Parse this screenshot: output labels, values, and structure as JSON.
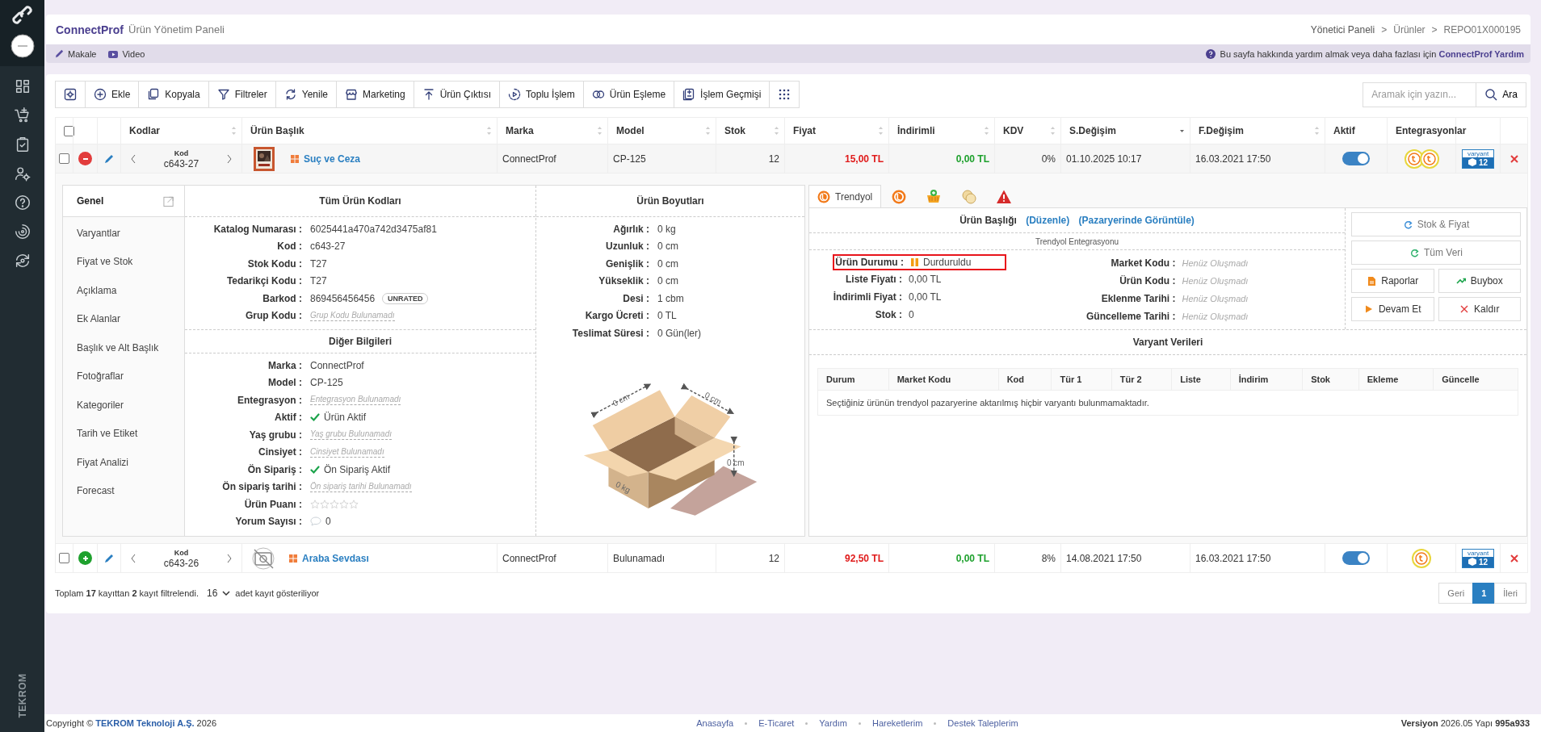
{
  "sidebar": {
    "brand": "TEKROM"
  },
  "header": {
    "app_name": "ConnectProf",
    "subtitle": "Ürün Yönetim Paneli",
    "breadcrumb": [
      "Yönetici Paneli",
      ">",
      "Ürünler",
      ">",
      "REPO01X000195"
    ]
  },
  "help_bar": {
    "links": [
      "Makale",
      "Video"
    ],
    "help_text": "Bu sayfa hakkında yardım almak veya daha fazlası için",
    "help_link": "ConnectProf Yardım"
  },
  "toolbar": {
    "buttons": [
      {
        "kind": "icon"
      },
      {
        "kind": "labeled",
        "label": "Ekle"
      },
      {
        "kind": "labeled",
        "label": "Kopyala"
      },
      {
        "kind": "labeled",
        "label": "Filtreler"
      },
      {
        "kind": "labeled",
        "label": "Yenile"
      },
      {
        "kind": "labeled",
        "label": "Marketing"
      },
      {
        "kind": "labeled",
        "label": "Ürün Çıktısı"
      },
      {
        "kind": "labeled",
        "label": "Toplu İşlem"
      },
      {
        "kind": "labeled",
        "label": "Ürün Eşleme"
      },
      {
        "kind": "labeled",
        "label": "İşlem Geçmişi"
      },
      {
        "kind": "icon"
      }
    ]
  },
  "search": {
    "placeholder": "Aramak için yazın...",
    "button": "Ara"
  },
  "table": {
    "header_checkbox": {
      "checked": false
    },
    "columns": [
      {
        "label": "Kodlar",
        "sortable": true,
        "sorted": false
      },
      {
        "label": "Ürün Başlık",
        "sortable": true,
        "sorted": false
      },
      {
        "label": "Marka",
        "sortable": true,
        "sorted": false
      },
      {
        "label": "Model",
        "sortable": true,
        "sorted": false
      },
      {
        "label": "Stok",
        "sortable": true,
        "sorted": false
      },
      {
        "label": "Fiyat",
        "sortable": true,
        "sorted": false
      },
      {
        "label": "İndirimli",
        "sortable": true,
        "sorted": false
      },
      {
        "label": "KDV",
        "sortable": true,
        "sorted": false
      },
      {
        "label": "S.Değişim",
        "sortable": true,
        "sorted": true
      },
      {
        "label": "F.Değişim",
        "sortable": true,
        "sorted": false
      },
      {
        "label": "Aktif",
        "sortable": false
      },
      {
        "label": "Entegrasyonlar",
        "sortable": false
      }
    ],
    "rows": [
      {
        "checked": false,
        "expanded": true,
        "code_label": "Kod",
        "code": "c643-27",
        "image": {
          "kind": "picture"
        },
        "title": "Suç ve Ceza",
        "brand": "ConnectProf",
        "model": "CP-125",
        "stock": "12",
        "price": "15,00 TL",
        "discount_price": "0,00 TL",
        "vat": "0%",
        "s_date": "01.10.2025 10:17",
        "f_date": "16.03.2021 17:50",
        "active": true,
        "integrations": [
          {
            "kind": "marketplace"
          },
          {
            "kind": "marketplace"
          }
        ],
        "variant_label": "varyant",
        "variant_count": "12",
        "detail": {
          "nav": [
            {
              "label": "Genel",
              "selected": true
            },
            {
              "label": "Varyantlar",
              "selected": false
            },
            {
              "label": "Fiyat ve Stok",
              "selected": false
            },
            {
              "label": "Açıklama",
              "selected": false
            },
            {
              "label": "Ek Alanlar",
              "selected": false
            },
            {
              "label": "Başlık ve Alt Başlık",
              "selected": false
            },
            {
              "label": "Fotoğraflar",
              "selected": false
            },
            {
              "label": "Kategoriler",
              "selected": false
            },
            {
              "label": "Tarih ve Etiket",
              "selected": false
            },
            {
              "label": "Fiyat Analizi",
              "selected": false
            },
            {
              "label": "Forecast",
              "selected": false
            }
          ],
          "codes": {
            "title": "Tüm Ürün Kodları",
            "fields": [
              {
                "label": "Katalog Numarası :",
                "kind": "text",
                "value": "6025441a470a742d3475af81"
              },
              {
                "label": "Kod :",
                "kind": "text",
                "value": "c643-27"
              },
              {
                "label": "Stok Kodu :",
                "kind": "text",
                "value": "T27"
              },
              {
                "label": "Tedarikçi Kodu :",
                "kind": "text",
                "value": "T27"
              },
              {
                "label": "Barkod :",
                "kind": "badge",
                "value": "869456456456",
                "badge": "UNRATED"
              },
              {
                "label": "Grup Kodu :",
                "kind": "missing",
                "value": "Grup Kodu Bulunamadı"
              }
            ]
          },
          "other": {
            "title": "Diğer Bilgileri",
            "fields": [
              {
                "label": "Marka :",
                "kind": "text",
                "value": "ConnectProf"
              },
              {
                "label": "Model :",
                "kind": "text",
                "value": "CP-125"
              },
              {
                "label": "Entegrasyon :",
                "kind": "missing",
                "value": "Entegrasyon Bulunamadı"
              },
              {
                "label": "Aktif :",
                "kind": "check",
                "value": "Ürün Aktif"
              },
              {
                "label": "Yaş grubu :",
                "kind": "missing",
                "value": "Yaş grubu Bulunamadı"
              },
              {
                "label": "Cinsiyet :",
                "kind": "missing",
                "value": "Cinsiyet Bulunamadı"
              },
              {
                "label": "Ön Sipariş :",
                "kind": "check",
                "value": "Ön Sipariş Aktif"
              },
              {
                "label": "Ön sipariş tarihi :",
                "kind": "missing",
                "value": "Ön sipariş tarihi Bulunamadı"
              },
              {
                "label": "Ürün Puanı :",
                "kind": "stars",
                "stars": 0
              },
              {
                "label": "Yorum Sayısı :",
                "kind": "comment",
                "value": "0"
              }
            ]
          },
          "dimensions": {
            "title": "Ürün Boyutları",
            "fields": [
              {
                "label": "Ağırlık :",
                "kind": "text",
                "value": "0 kg"
              },
              {
                "label": "Uzunluk :",
                "kind": "text",
                "value": "0 cm"
              },
              {
                "label": "Genişlik :",
                "kind": "text",
                "value": "0 cm"
              },
              {
                "label": "Yükseklik :",
                "kind": "text",
                "value": "0 cm"
              },
              {
                "label": "Desi :",
                "kind": "text",
                "value": "1 cbm"
              },
              {
                "label": "Kargo Ücreti :",
                "kind": "text",
                "value": "0 TL"
              },
              {
                "label": "Teslimat Süresi :",
                "kind": "text",
                "value": "0 Gün(ler)"
              }
            ],
            "box_labels": {
              "length": "0 cm",
              "width": "0 cm",
              "height": "0 cm",
              "weight": "0 kg"
            }
          },
          "marketplace": {
            "tabs": [
              {
                "label": "Trendyol",
                "selected": true
              },
              {
                "selected": false
              },
              {
                "selected": false
              },
              {
                "selected": false
              },
              {
                "selected": false
              }
            ],
            "title_label": "Ürün Başlığı",
            "title_links": [
              "(Düzenle)",
              "(Pazaryerinde Görüntüle)"
            ],
            "integration_label": "Trendyol Entegrasyonu",
            "status": {
              "label": "Ürün Durumu :",
              "value": "Durduruldu",
              "highlighted": true
            },
            "left_fields": [
              {
                "label": "Liste Fiyatı :",
                "value": "0,00 TL"
              },
              {
                "label": "İndirimli Fiyat :",
                "value": "0,00 TL"
              },
              {
                "label": "Stok :",
                "value": "0"
              }
            ],
            "right_fields": [
              {
                "label": "Market Kodu :",
                "value": "Henüz Oluşmadı"
              },
              {
                "label": "Ürün Kodu :",
                "value": "Henüz Oluşmadı"
              },
              {
                "label": "Eklenme Tarihi :",
                "value": "Henüz Oluşmadı"
              },
              {
                "label": "Güncelleme Tarihi :",
                "value": "Henüz Oluşmadı"
              }
            ],
            "actions": [
              {
                "label": "Stok & Fiyat",
                "kind": "wide"
              },
              {
                "label": "Tüm Veri",
                "kind": "wide"
              },
              {
                "label": "Raporlar",
                "kind": "half"
              },
              {
                "label": "Buybox",
                "kind": "half"
              },
              {
                "label": "Devam Et",
                "kind": "half"
              },
              {
                "label": "Kaldır",
                "kind": "half"
              }
            ],
            "variants": {
              "title": "Varyant Verileri",
              "columns": [
                "Durum",
                "Market Kodu",
                "Kod",
                "Tür 1",
                "Tür 2",
                "Liste",
                "İndirim",
                "Stok",
                "Ekleme",
                "Güncelle"
              ],
              "empty_message": "Seçtiğiniz ürünün trendyol pazaryerine aktarılmış hiçbir varyantı bulunmamaktadır."
            }
          }
        }
      },
      {
        "checked": false,
        "expanded": false,
        "code_label": "Kod",
        "code": "c643-26",
        "image": {
          "kind": "placeholder"
        },
        "title": "Araba Sevdası",
        "brand": "ConnectProf",
        "model": "Bulunamadı",
        "stock": "12",
        "price": "92,50 TL",
        "discount_price": "0,00 TL",
        "vat": "8%",
        "s_date": "14.08.2021 17:50",
        "f_date": "16.03.2021 17:50",
        "active": true,
        "integrations": [
          {
            "kind": "marketplace"
          }
        ],
        "variant_label": "varyant",
        "variant_count": "12"
      }
    ]
  },
  "table_footer": {
    "summary": "Toplam **17** kayıttan **2** kayıt filtrelendi.",
    "page_size": "16",
    "page_size_suffix": "adet kayıt gösteriliyor"
  },
  "pagination": [
    {
      "label": "Geri",
      "selected": false
    },
    {
      "label": "1",
      "selected": true
    },
    {
      "label": "İleri",
      "selected": false
    }
  ],
  "footer": {
    "copyright": "Copyright © **TEKROM Teknoloji A.Ş.** 2026",
    "links": [
      "Anasayfa",
      "E-Ticaret",
      "Yardım",
      "Hareketlerim",
      "Destek Taleplerim"
    ],
    "version": "**Versiyon** 2026.05 Yapı **995a933**"
  }
}
